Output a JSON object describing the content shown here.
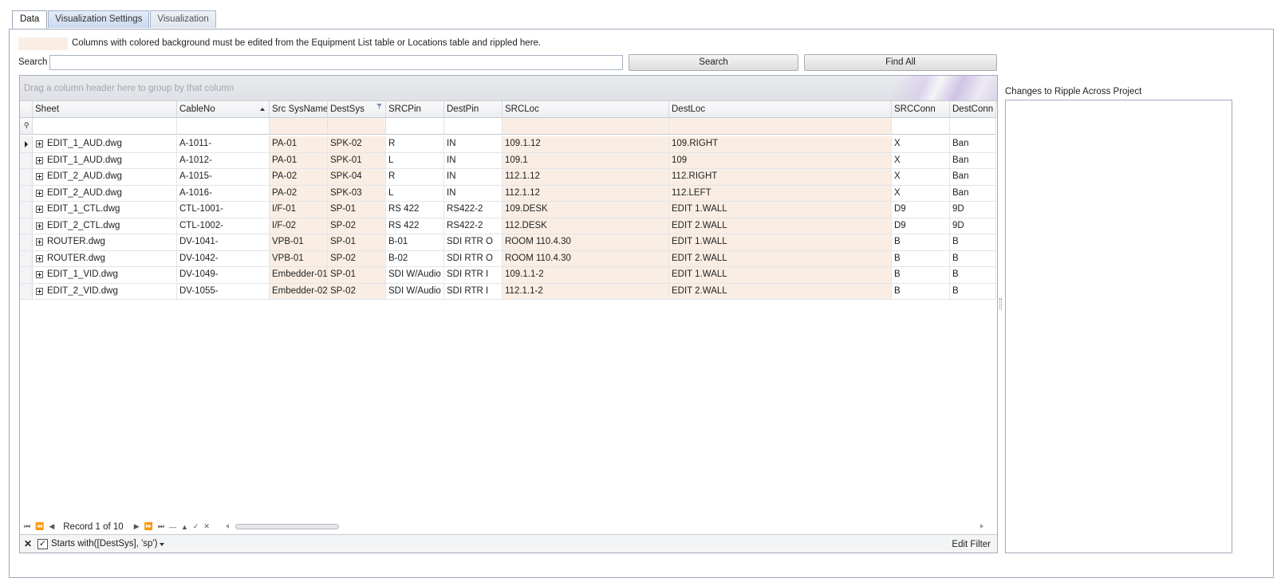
{
  "tabs": [
    "Data",
    "Visualization Settings",
    "Visualization"
  ],
  "legend": {
    "text": "Columns with colored background must be edited from the Equipment List table or Locations table and rippled here.",
    "color": "#faeee4"
  },
  "search": {
    "label": "Search",
    "value": "",
    "search_button": "Search",
    "findall_button": "Find All"
  },
  "grid": {
    "group_hint": "Drag a column header here to group by that column",
    "columns": [
      "Sheet",
      "CableNo",
      "Src SysName",
      "DestSys",
      "SRCPin",
      "DestPin",
      "SRCLoc",
      "DestLoc",
      "SRCConn",
      "DestConn"
    ],
    "rows": [
      [
        "EDIT_1_AUD.dwg",
        "A-1011-",
        "PA-01",
        "SPK-02",
        "R",
        "IN",
        "109.1.12",
        "109.RIGHT",
        "X",
        "Ban"
      ],
      [
        "EDIT_1_AUD.dwg",
        "A-1012-",
        "PA-01",
        "SPK-01",
        "L",
        "IN",
        "109.1",
        "109",
        "X",
        "Ban"
      ],
      [
        "EDIT_2_AUD.dwg",
        "A-1015-",
        "PA-02",
        "SPK-04",
        "R",
        "IN",
        "112.1.12",
        "112.RIGHT",
        "X",
        "Ban"
      ],
      [
        "EDIT_2_AUD.dwg",
        "A-1016-",
        "PA-02",
        "SPK-03",
        "L",
        "IN",
        "112.1.12",
        "112.LEFT",
        "X",
        "Ban"
      ],
      [
        "EDIT_1_CTL.dwg",
        "CTL-1001-",
        "I/F-01",
        "SP-01",
        "RS 422",
        "RS422-2",
        "109.DESK",
        "EDIT 1.WALL",
        "D9",
        "9D"
      ],
      [
        "EDIT_2_CTL.dwg",
        "CTL-1002-",
        "I/F-02",
        "SP-02",
        "RS 422",
        "RS422-2",
        "112.DESK",
        "EDIT 2.WALL",
        "D9",
        "9D"
      ],
      [
        "ROUTER.dwg",
        "DV-1041-",
        "VPB-01",
        "SP-01",
        "B-01",
        "SDI RTR O",
        "ROOM 110.4.30",
        "EDIT 1.WALL",
        "B",
        "B"
      ],
      [
        "ROUTER.dwg",
        "DV-1042-",
        "VPB-01",
        "SP-02",
        "B-02",
        "SDI RTR O",
        "ROOM 110.4.30",
        "EDIT 2.WALL",
        "B",
        "B"
      ],
      [
        "EDIT_1_VID.dwg",
        "DV-1049-",
        "Embedder-01",
        "SP-01",
        "SDI W/Audio",
        "SDI RTR I",
        "109.1.1-2",
        "EDIT 1.WALL",
        "B",
        "B"
      ],
      [
        "EDIT_2_VID.dwg",
        "DV-1055-",
        "Embedder-02",
        "SP-02",
        "SDI W/Audio",
        "SDI RTR I",
        "112.1.1-2",
        "EDIT 2.WALL",
        "B",
        "B"
      ]
    ]
  },
  "navigator": {
    "record_text": "Record 1 of 10"
  },
  "filter": {
    "text": "Starts with([DestSys], 'sp')",
    "checked": true,
    "edit_label": "Edit Filter"
  },
  "changes": {
    "label": "Changes to Ripple Across Project"
  }
}
